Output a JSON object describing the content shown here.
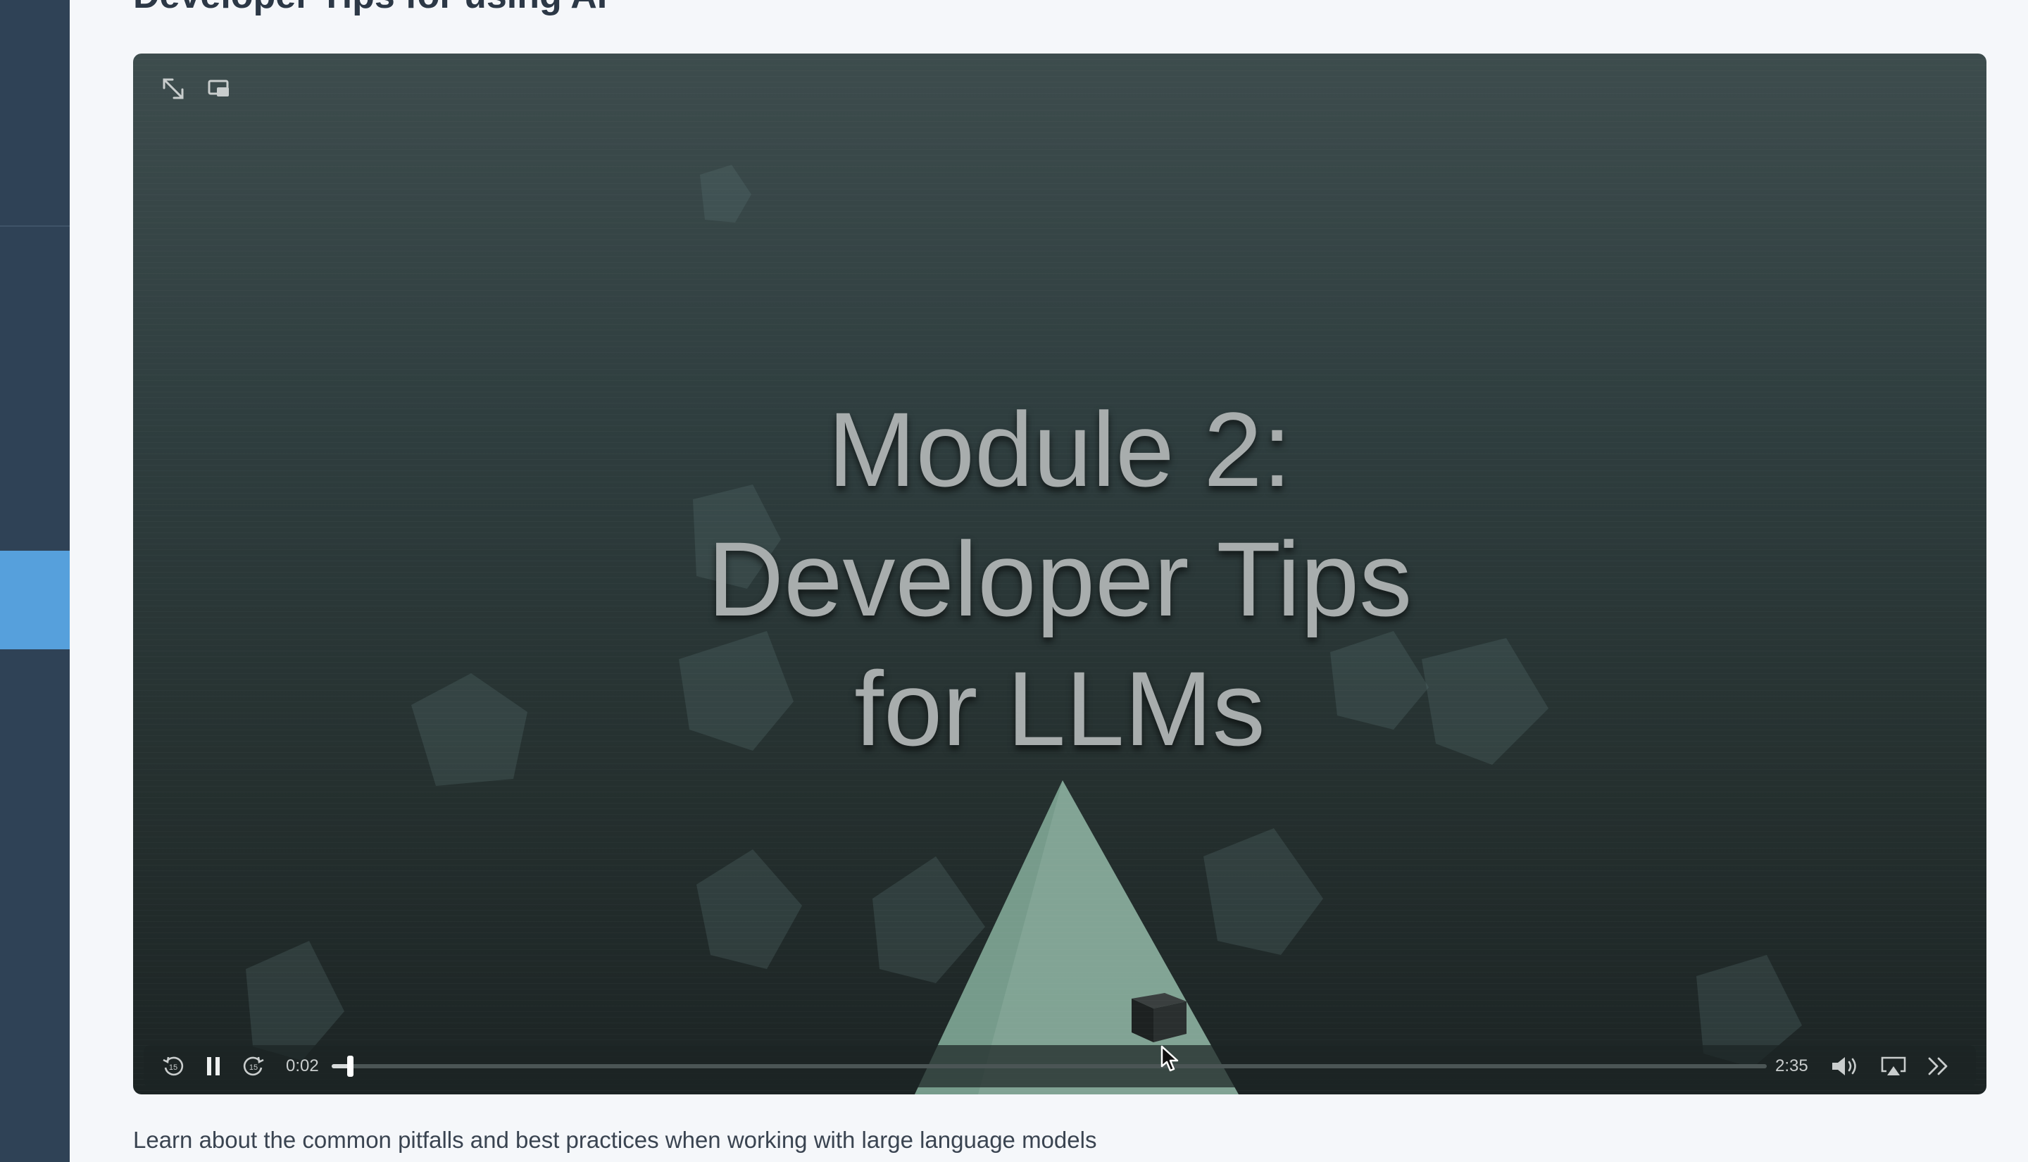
{
  "page": {
    "heading": "Developer Tips for using AI",
    "description": "Learn about the common pitfalls and best practices when working with large language models"
  },
  "video": {
    "title_lines": [
      "Module 2:",
      "Developer Tips",
      "for LLMs"
    ],
    "current_time": "0:02",
    "duration": "2:35",
    "progress_fraction": 0.013,
    "state": "playing"
  },
  "icons": {
    "fullscreen": "expand-arrows-icon",
    "pip": "picture-in-picture-icon",
    "rewind": "rewind-15-icon",
    "pause": "pause-icon",
    "forward": "forward-15-icon",
    "volume": "volume-icon",
    "airplay": "airplay-icon",
    "more": "double-chevron-right-icon"
  },
  "colors": {
    "sidebar": "#2f4256",
    "sidebar_active": "#56a0dc",
    "page_background": "#f5f7fa",
    "video_background": "#2f3e3f",
    "cone": "#8fb5a4"
  }
}
